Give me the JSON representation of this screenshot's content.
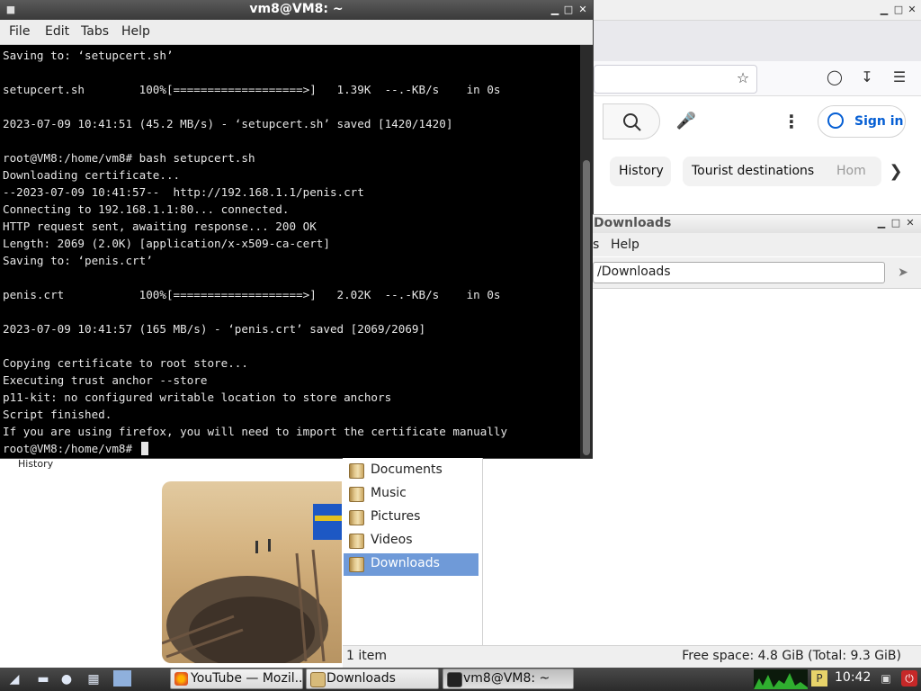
{
  "terminal": {
    "title": "vm8@VM8: ~",
    "menu": [
      "File",
      "Edit",
      "Tabs",
      "Help"
    ],
    "lines": [
      "Saving to: ‘setupcert.sh’",
      "",
      "setupcert.sh        100%[===================>]   1.39K  --.-KB/s    in 0s",
      "",
      "2023-07-09 10:41:51 (45.2 MB/s) - ‘setupcert.sh’ saved [1420/1420]",
      "",
      "root@VM8:/home/vm8# bash setupcert.sh",
      "Downloading certificate...",
      "--2023-07-09 10:41:57--  http://192.168.1.1/penis.crt",
      "Connecting to 192.168.1.1:80... connected.",
      "HTTP request sent, awaiting response... 200 OK",
      "Length: 2069 (2.0K) [application/x-x509-ca-cert]",
      "Saving to: ‘penis.crt’",
      "",
      "penis.crt           100%[===================>]   2.02K  --.-KB/s    in 0s",
      "",
      "2023-07-09 10:41:57 (165 MB/s) - ‘penis.crt’ saved [2069/2069]",
      "",
      "Copying certificate to root store...",
      "Executing trust anchor --store",
      "p11-kit: no configured writable location to store anchors",
      "Script finished.",
      "If you are using firefox, you will need to import the certificate manually"
    ],
    "prompt": "root@VM8:/home/vm8# "
  },
  "firefox": {
    "chips": [
      "History",
      "Tourist destinations",
      "Hom"
    ],
    "sign_in": "Sign in",
    "history_label": "History"
  },
  "file_manager": {
    "title": "Downloads",
    "menu_partial": "s",
    "menu_help": "Help",
    "path": "/Downloads",
    "places": [
      {
        "label": "Documents",
        "selected": false
      },
      {
        "label": "Music",
        "selected": false
      },
      {
        "label": "Pictures",
        "selected": false
      },
      {
        "label": "Videos",
        "selected": false
      },
      {
        "label": "Downloads",
        "selected": true
      }
    ],
    "status_items": "1 item",
    "status_free": "Free space: 4.8 GiB (Total: 9.3 GiB)"
  },
  "taskbar": {
    "tasks": [
      {
        "label": "YouTube — Mozil...",
        "icon": "firefox-icon",
        "active": false
      },
      {
        "label": "Downloads",
        "icon": "folder-icon",
        "active": false
      },
      {
        "label": "vm8@VM8: ~",
        "icon": "terminal-icon",
        "active": true
      }
    ],
    "clock": "10:42"
  },
  "colors": {
    "terminal_bg": "#000000",
    "terminal_fg": "#e6e6e6",
    "selection": "#6f9ad8",
    "youtube_link": "#065fd4"
  }
}
